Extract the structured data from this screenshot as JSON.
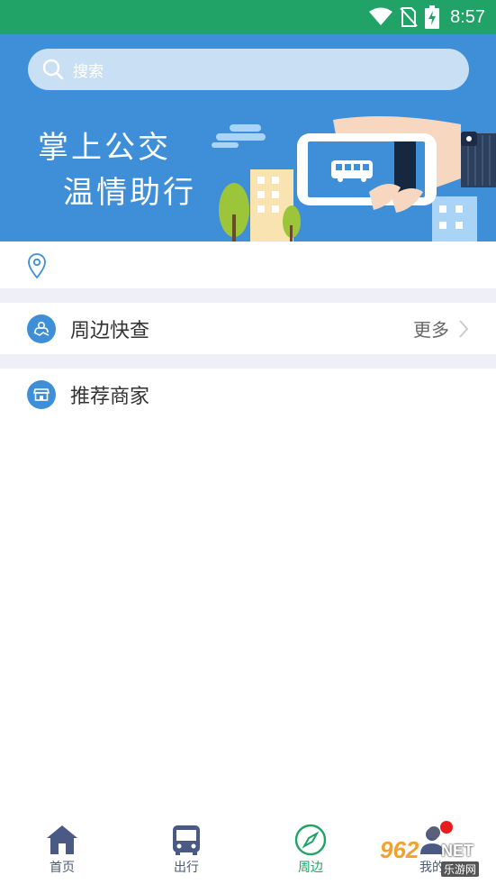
{
  "status_bar": {
    "time": "8:57",
    "icons": [
      "wifi-icon",
      "no-sim-icon",
      "battery-charging-icon"
    ]
  },
  "search": {
    "placeholder": "搜索"
  },
  "banner": {
    "title": "掌上公交",
    "subtitle": "温情助行"
  },
  "location": {
    "text": ""
  },
  "nearby": {
    "label": "周边快查",
    "more": "更多"
  },
  "recommend": {
    "label": "推荐商家"
  },
  "tabs": [
    {
      "label": "首页",
      "icon": "home-icon"
    },
    {
      "label": "出行",
      "icon": "bus-icon"
    },
    {
      "label": "周边",
      "icon": "compass-icon",
      "active": true
    },
    {
      "label": "我的",
      "icon": "profile-icon"
    }
  ],
  "watermark": {
    "text": "962",
    "suffix": "NET",
    "sub": "乐游网"
  },
  "colors": {
    "status_bar": "#21a266",
    "banner": "#3f8fd8",
    "accent_green": "#21a266",
    "icon_blue": "#3f8fd8",
    "separator": "#efeff7"
  }
}
